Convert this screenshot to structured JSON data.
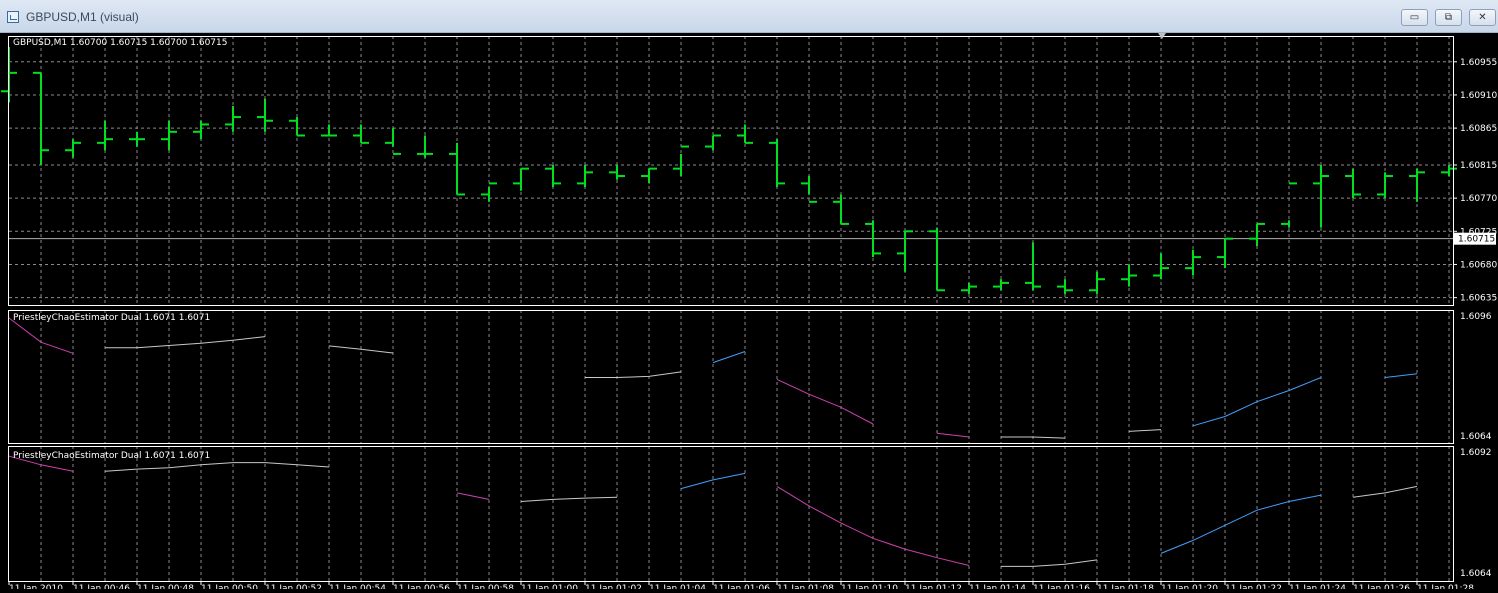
{
  "window": {
    "title": "GBPUSD,M1 (visual)",
    "icon": "chart-window-icon",
    "controls": {
      "minimize": "▭",
      "restore": "⧉",
      "close": "✕"
    }
  },
  "main_chart": {
    "header": "GBPUSD,M1  1.60700 1.60715 1.60700 1.60715",
    "price_labels": [
      "1.60955",
      "1.60910",
      "1.60865",
      "1.60815",
      "1.60770",
      "1.60725",
      "1.60680",
      "1.60635"
    ],
    "current_price": "1.60715",
    "colors": {
      "bars": "#00e020",
      "grid": "#b0b0b0",
      "bid_line": "#b0b0b0"
    }
  },
  "indicator_1": {
    "header": "PriestleyChaoEstimator Dual 1.6071 1.6071",
    "scale_top": "1.6096",
    "scale_bottom": "1.6064"
  },
  "indicator_2": {
    "header": "PriestleyChaoEstimator Dual 1.6071 1.6071",
    "scale_top": "1.6092",
    "scale_bottom": "1.6064"
  },
  "time_labels": [
    "11 Jan 2010",
    "11 Jan 00:46",
    "11 Jan 00:48",
    "11 Jan 00:50",
    "11 Jan 00:52",
    "11 Jan 00:54",
    "11 Jan 00:56",
    "11 Jan 00:58",
    "11 Jan 01:00",
    "11 Jan 01:02",
    "11 Jan 01:04",
    "11 Jan 01:06",
    "11 Jan 01:08",
    "11 Jan 01:10",
    "11 Jan 01:12",
    "11 Jan 01:14",
    "11 Jan 01:16",
    "11 Jan 01:18",
    "11 Jan 01:20",
    "11 Jan 01:22",
    "11 Jan 01:24",
    "11 Jan 01:26",
    "11 Jan 01:28"
  ],
  "chart_data": [
    {
      "type": "ohlc",
      "title": "GBPUSD,M1",
      "note": "1-minute bars, 46 bars from 00:44 to 01:29; values are prices",
      "x": [
        "00:44",
        "00:45",
        "00:46",
        "00:47",
        "00:48",
        "00:49",
        "00:50",
        "00:51",
        "00:52",
        "00:53",
        "00:54",
        "00:55",
        "00:56",
        "00:57",
        "00:58",
        "00:59",
        "01:00",
        "01:01",
        "01:02",
        "01:03",
        "01:04",
        "01:05",
        "01:06",
        "01:07",
        "01:08",
        "01:09",
        "01:10",
        "01:11",
        "01:12",
        "01:13",
        "01:14",
        "01:15",
        "01:16",
        "01:17",
        "01:18",
        "01:19",
        "01:20",
        "01:21",
        "01:22",
        "01:23",
        "01:24",
        "01:25",
        "01:26",
        "01:27",
        "01:28",
        "01:29"
      ],
      "open": [
        1.60915,
        1.6094,
        1.60835,
        1.60845,
        1.6085,
        1.6085,
        1.6086,
        1.6087,
        1.6088,
        1.60875,
        1.60855,
        1.60855,
        1.60845,
        1.6083,
        1.6083,
        1.60775,
        1.6079,
        1.6081,
        1.6079,
        1.60805,
        1.608,
        1.6081,
        1.6084,
        1.60855,
        1.60845,
        1.6079,
        1.60765,
        1.60735,
        1.60695,
        1.60725,
        1.60645,
        1.6065,
        1.60655,
        1.6065,
        1.60645,
        1.6066,
        1.60665,
        1.60675,
        1.6069,
        1.60715,
        1.60735,
        1.6079,
        1.608,
        1.60775,
        1.608,
        1.60805
      ],
      "high": [
        1.60975,
        1.6094,
        1.6085,
        1.60875,
        1.6086,
        1.60875,
        1.60875,
        1.60895,
        1.60905,
        1.6088,
        1.6087,
        1.6087,
        1.60865,
        1.60855,
        1.60845,
        1.60785,
        1.6081,
        1.60815,
        1.60815,
        1.60815,
        1.6081,
        1.6083,
        1.60855,
        1.6087,
        1.6085,
        1.608,
        1.60775,
        1.6074,
        1.60725,
        1.6073,
        1.60655,
        1.6066,
        1.6071,
        1.6066,
        1.6067,
        1.6068,
        1.60695,
        1.607,
        1.60715,
        1.60735,
        1.6074,
        1.60815,
        1.6081,
        1.60805,
        1.6081,
        1.60815
      ],
      "low": [
        1.609,
        1.60815,
        1.60825,
        1.60835,
        1.6084,
        1.60835,
        1.6085,
        1.6086,
        1.6086,
        1.60855,
        1.60855,
        1.60845,
        1.6084,
        1.60825,
        1.60775,
        1.60765,
        1.6078,
        1.60785,
        1.60785,
        1.60795,
        1.6079,
        1.608,
        1.60835,
        1.60845,
        1.60785,
        1.60775,
        1.60735,
        1.6069,
        1.6067,
        1.60645,
        1.6064,
        1.60645,
        1.60645,
        1.6064,
        1.6064,
        1.6065,
        1.6066,
        1.60665,
        1.60675,
        1.60705,
        1.6073,
        1.6073,
        1.6077,
        1.6077,
        1.60765,
        1.608
      ],
      "close": [
        1.6094,
        1.60835,
        1.60845,
        1.6085,
        1.6085,
        1.6086,
        1.6087,
        1.6088,
        1.60875,
        1.60855,
        1.60855,
        1.60845,
        1.6083,
        1.6083,
        1.60775,
        1.6079,
        1.6081,
        1.6079,
        1.60805,
        1.608,
        1.6081,
        1.6084,
        1.60855,
        1.60845,
        1.6079,
        1.60765,
        1.60735,
        1.60695,
        1.60725,
        1.60645,
        1.6065,
        1.60655,
        1.6065,
        1.60645,
        1.6066,
        1.60665,
        1.60675,
        1.6069,
        1.60715,
        1.60735,
        1.6079,
        1.608,
        1.60775,
        1.608,
        1.60805,
        1.6081
      ],
      "bid_line": 1.60715,
      "ylim": [
        1.60625,
        1.6099
      ]
    },
    {
      "type": "line",
      "title": "PriestleyChaoEstimator Dual",
      "ylim": [
        1.6064,
        1.6096
      ],
      "segments": [
        {
          "color": "#d040b0",
          "x": [
            "00:44",
            "00:45",
            "00:46"
          ],
          "y": [
            1.6096,
            1.60895,
            1.60865
          ]
        },
        {
          "color": "#c8c8c8",
          "x": [
            "00:47",
            "00:48",
            "00:49",
            "00:50",
            "00:51",
            "00:52"
          ],
          "y": [
            1.6088,
            1.6088,
            1.60886,
            1.60892,
            1.609,
            1.6091
          ]
        },
        {
          "color": "#c8c8c8",
          "x": [
            "00:54",
            "00:55",
            "00:56"
          ],
          "y": [
            1.60885,
            1.60876,
            1.60866
          ]
        },
        {
          "color": "#c8c8c8",
          "x": [
            "01:02",
            "01:03",
            "01:04",
            "01:05"
          ],
          "y": [
            1.608,
            1.608,
            1.60803,
            1.60815
          ]
        },
        {
          "color": "#40a0ff",
          "x": [
            "01:06",
            "01:07"
          ],
          "y": [
            1.6084,
            1.6087
          ]
        },
        {
          "color": "#d040b0",
          "x": [
            "01:08",
            "01:09",
            "01:10",
            "01:11"
          ],
          "y": [
            1.60795,
            1.60755,
            1.6072,
            1.60675
          ]
        },
        {
          "color": "#d040b0",
          "x": [
            "01:13",
            "01:14"
          ],
          "y": [
            1.6065,
            1.6064
          ]
        },
        {
          "color": "#c8c8c8",
          "x": [
            "01:15",
            "01:16",
            "01:17"
          ],
          "y": [
            1.6064,
            1.6064,
            1.60637
          ]
        },
        {
          "color": "#c8c8c8",
          "x": [
            "01:19",
            "01:20"
          ],
          "y": [
            1.60655,
            1.6066
          ]
        },
        {
          "color": "#40a0ff",
          "x": [
            "01:21",
            "01:22",
            "01:23",
            "01:24",
            "01:25"
          ],
          "y": [
            1.6067,
            1.60695,
            1.60735,
            1.60765,
            1.608
          ]
        },
        {
          "color": "#40a0ff",
          "x": [
            "01:27",
            "01:28"
          ],
          "y": [
            1.608,
            1.6081
          ]
        }
      ]
    },
    {
      "type": "line",
      "title": "PriestleyChaoEstimator Dual",
      "ylim": [
        1.6064,
        1.6092
      ],
      "segments": [
        {
          "color": "#d040b0",
          "x": [
            "00:44",
            "00:45",
            "00:46"
          ],
          "y": [
            1.60915,
            1.60895,
            1.6088
          ]
        },
        {
          "color": "#c8c8c8",
          "x": [
            "00:47",
            "00:48",
            "00:49",
            "00:50",
            "00:51",
            "00:52",
            "00:53",
            "00:54"
          ],
          "y": [
            1.6088,
            1.60885,
            1.60888,
            1.60895,
            1.609,
            1.609,
            1.60895,
            1.6089
          ]
        },
        {
          "color": "#d040b0",
          "x": [
            "00:58",
            "00:59"
          ],
          "y": [
            1.6083,
            1.60815
          ]
        },
        {
          "color": "#c8c8c8",
          "x": [
            "01:00",
            "01:01",
            "01:02",
            "01:03"
          ],
          "y": [
            1.6081,
            1.60815,
            1.60818,
            1.6082
          ]
        },
        {
          "color": "#40a0ff",
          "x": [
            "01:05",
            "01:06",
            "01:07"
          ],
          "y": [
            1.6084,
            1.6086,
            1.60875
          ]
        },
        {
          "color": "#d040b0",
          "x": [
            "01:08",
            "01:09",
            "01:10",
            "01:11",
            "01:12",
            "01:13",
            "01:14"
          ],
          "y": [
            1.60845,
            1.608,
            1.6076,
            1.60725,
            1.607,
            1.6068,
            1.60662
          ]
        },
        {
          "color": "#c8c8c8",
          "x": [
            "01:15",
            "01:16",
            "01:17",
            "01:18"
          ],
          "y": [
            1.6066,
            1.6066,
            1.60665,
            1.60675
          ]
        },
        {
          "color": "#40a0ff",
          "x": [
            "01:20",
            "01:21",
            "01:22",
            "01:23",
            "01:24",
            "01:25"
          ],
          "y": [
            1.6069,
            1.6072,
            1.60755,
            1.6079,
            1.6081,
            1.60825
          ]
        },
        {
          "color": "#c8c8c8",
          "x": [
            "01:26",
            "01:27",
            "01:28"
          ],
          "y": [
            1.6082,
            1.6083,
            1.60845
          ]
        }
      ]
    }
  ]
}
